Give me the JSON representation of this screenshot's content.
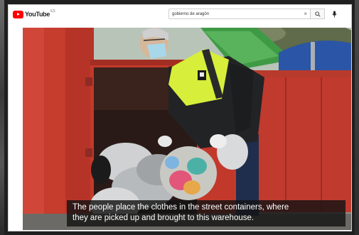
{
  "header": {
    "logo_text": "YouTube",
    "logo_region": "ES"
  },
  "search": {
    "query": "gobierno de aragón",
    "clear_glyph": "×"
  },
  "video": {
    "subtitle_line1": "The people place the clothes in the street containers, where",
    "subtitle_line2": "they are picked up and brought to this warehouse."
  },
  "colors": {
    "brand": "#ff0000",
    "container": "#c2392b",
    "vest": "#d7ef3a"
  },
  "icons": [
    "youtube-logo-icon",
    "clear-icon",
    "search-icon",
    "microphone-icon"
  ]
}
